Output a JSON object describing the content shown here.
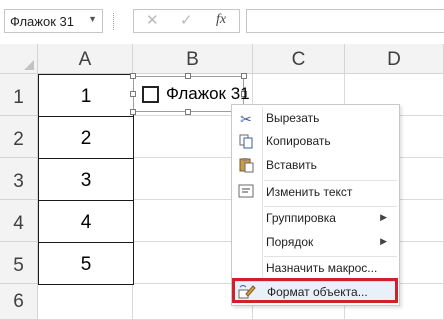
{
  "formula_bar": {
    "name_box": "Флажок 31",
    "cancel_glyph": "✕",
    "enter_glyph": "✓",
    "fx": "fx"
  },
  "columns": [
    "A",
    "B",
    "C",
    "D"
  ],
  "rows": [
    "1",
    "2",
    "3",
    "4",
    "5",
    "6"
  ],
  "cells_A": [
    "1",
    "2",
    "3",
    "4",
    "5"
  ],
  "checkbox": {
    "label": "Флажок 31",
    "checked": false
  },
  "context_menu": {
    "items": [
      {
        "label": "Вырезать",
        "icon": "scissors-icon"
      },
      {
        "label": "Копировать",
        "icon": "copy-icon"
      },
      {
        "label": "Вставить",
        "icon": "paste-icon"
      },
      {
        "label": "Изменить текст",
        "icon": "edit-text-icon"
      },
      {
        "label": "Группировка",
        "submenu": true
      },
      {
        "label": "Порядок",
        "submenu": true
      },
      {
        "label": "Назначить макрос..."
      },
      {
        "label": "Формат объекта...",
        "icon": "format-object-icon",
        "highlighted": true
      }
    ]
  },
  "colors": {
    "highlight_border": "#d0202a"
  }
}
